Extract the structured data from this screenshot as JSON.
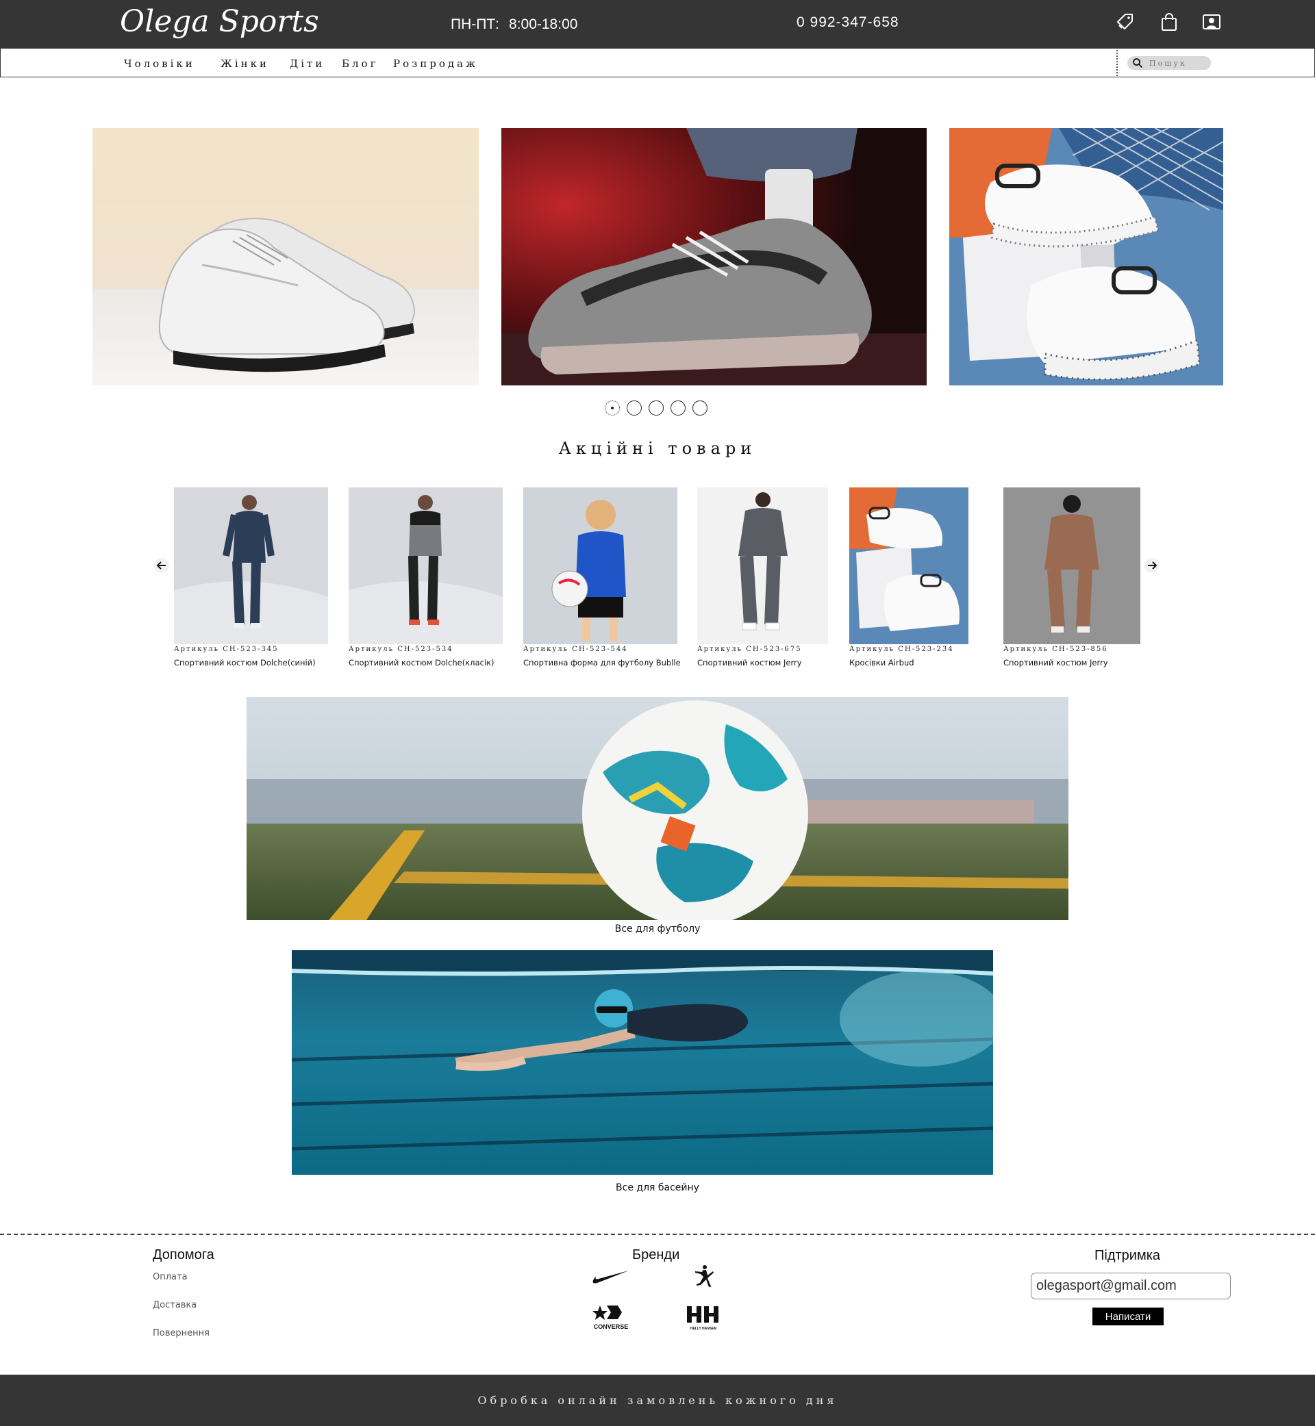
{
  "header": {
    "logo": "Olega Sports",
    "hours_days": "ПН-ПТ:",
    "hours_time": "8:00-18:00",
    "phone": "0 992-347-658",
    "icons": [
      "tag-icon",
      "shopping-bag-icon",
      "user-account-icon"
    ]
  },
  "nav": {
    "items": [
      "Чоловіки",
      "Жінки",
      "Діти",
      "Блог",
      "Розпродаж"
    ],
    "search_placeholder": "Пошук"
  },
  "hero": {
    "slides": [
      "white-sneaker-photo",
      "runner-sneakers-photo",
      "chunky-sneakers-photo"
    ],
    "dot_count": 5,
    "active_dot": 1
  },
  "promo": {
    "title": "Акційні товари",
    "products": [
      {
        "sku": "Артикуль CH-523-345",
        "name": "Спортивний костюм Dolche(синій)"
      },
      {
        "sku": "Артикуль CH-523-534",
        "name": "Спортивний костюм Dolche(класік)"
      },
      {
        "sku": "Артикуль CH-523-544",
        "name": "Спортивна форма для футболу Bublle"
      },
      {
        "sku": "Артикуль CH-523-675",
        "name": "Спортивний костюм Jerry"
      },
      {
        "sku": "Артикуль CH-523-234",
        "name": "Кросівки Airbud"
      },
      {
        "sku": "Артикуль CH-523-856",
        "name": "Спортивний костюм Jerry"
      }
    ]
  },
  "categories": [
    {
      "caption": "Все для футболу"
    },
    {
      "caption": "Все для басейну"
    }
  ],
  "footer": {
    "help_title": "Допомога",
    "help_links": [
      "Оплата",
      "Доставка",
      "Повернення"
    ],
    "brands_title": "Бренди",
    "brands": [
      "Nike",
      "Jordan",
      "CONVERSE",
      "HELLY HANSEN"
    ],
    "support_title": "Підтримка",
    "email_value": "olegasport@gmail.com",
    "send_label": "Написати",
    "bottom_text": "Обробка онлайн замовлень кожного дня"
  },
  "colors": {
    "dark_bar": "#353535",
    "button": "#000000",
    "search_bg": "#d9d9d9"
  }
}
